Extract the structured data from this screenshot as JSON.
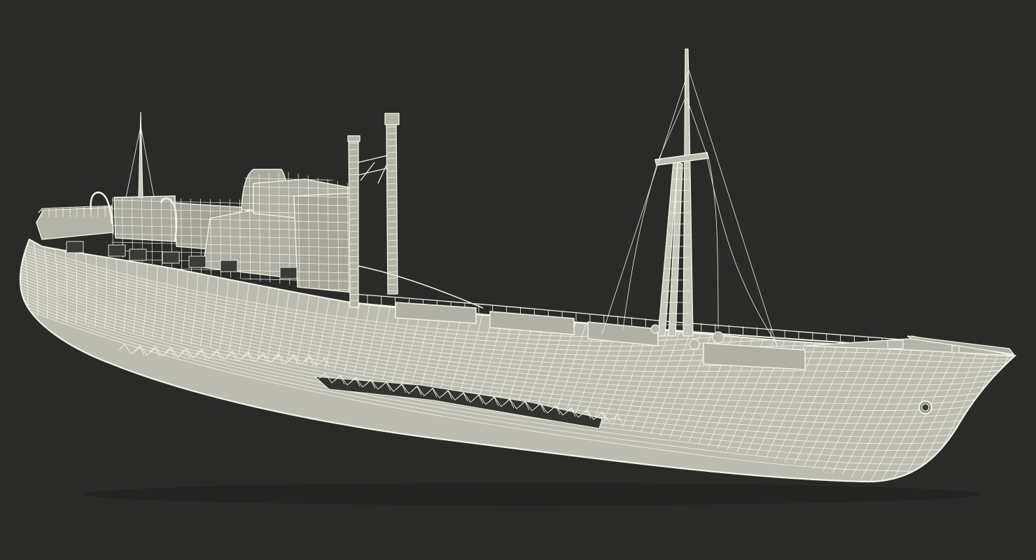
{
  "scene": {
    "subject": "wireframe-ship-model",
    "background_color": "#2a2a29",
    "hull_fill_color": "#bcbcb0",
    "structure_fill_color": "#a9a99e",
    "wire_color": "#f2f2e6",
    "shadow_color": "#20201f"
  }
}
